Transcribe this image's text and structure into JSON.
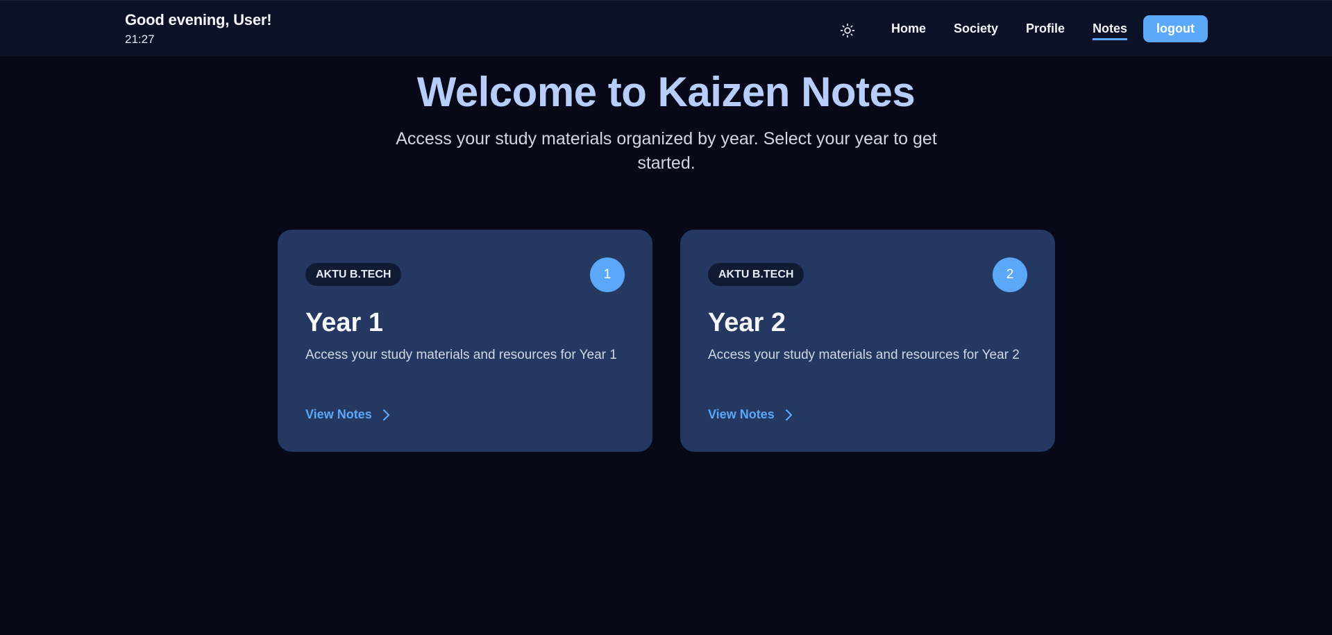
{
  "header": {
    "greeting": "Good evening, User!",
    "time": "21:27",
    "theme_icon": "sun-icon",
    "nav": {
      "home": "Home",
      "society": "Society",
      "profile": "Profile",
      "notes": "Notes"
    },
    "active_nav": "Notes",
    "logout_label": "logout"
  },
  "hero": {
    "title": "Welcome to Kaizen Notes",
    "subtitle": "Access your study materials organized by year. Select your year to get started."
  },
  "cards": [
    {
      "badge": "AKTU B.TECH",
      "number": "1",
      "title": "Year 1",
      "description": "Access your study materials and resources for Year 1",
      "link_label": "View Notes"
    },
    {
      "badge": "AKTU B.TECH",
      "number": "2",
      "title": "Year 2",
      "description": "Access your study materials and resources for Year 2",
      "link_label": "View Notes"
    }
  ],
  "colors": {
    "background": "#070818",
    "navbar": "#0b1127",
    "card": "#253862",
    "accent": "#5aa8f7",
    "hero_title": "#b7cdfa"
  }
}
